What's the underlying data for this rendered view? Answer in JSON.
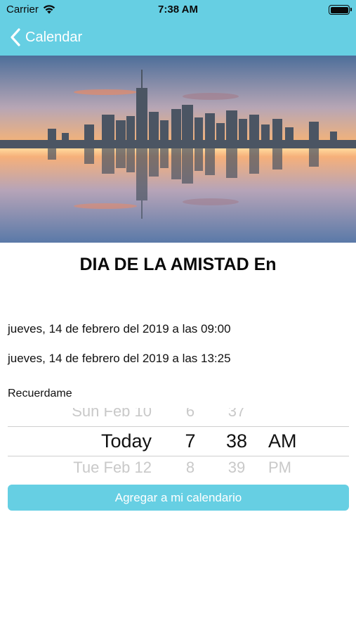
{
  "status_bar": {
    "carrier": "Carrier",
    "time": "7:38 AM"
  },
  "nav": {
    "back_label": "Calendar"
  },
  "event": {
    "title": "DIA DE LA AMISTAD En",
    "start": "jueves, 14 de febrero del 2019 a las 09:00",
    "end": "jueves, 14 de febrero del 2019 a las 13:25"
  },
  "reminder": {
    "label": "Recuerdame",
    "picker": {
      "above": {
        "day": "Sun Feb 10",
        "hour": "6",
        "minute": "37",
        "ampm": ""
      },
      "selected": {
        "day": "Today",
        "hour": "7",
        "minute": "38",
        "ampm": "AM"
      },
      "below": {
        "day": "Tue Feb 12",
        "hour": "8",
        "minute": "39",
        "ampm": "PM"
      }
    }
  },
  "actions": {
    "add_to_calendar": "Agregar a mi calendario"
  },
  "colors": {
    "accent": "#66cfe3",
    "button_text": "#ffffff"
  }
}
